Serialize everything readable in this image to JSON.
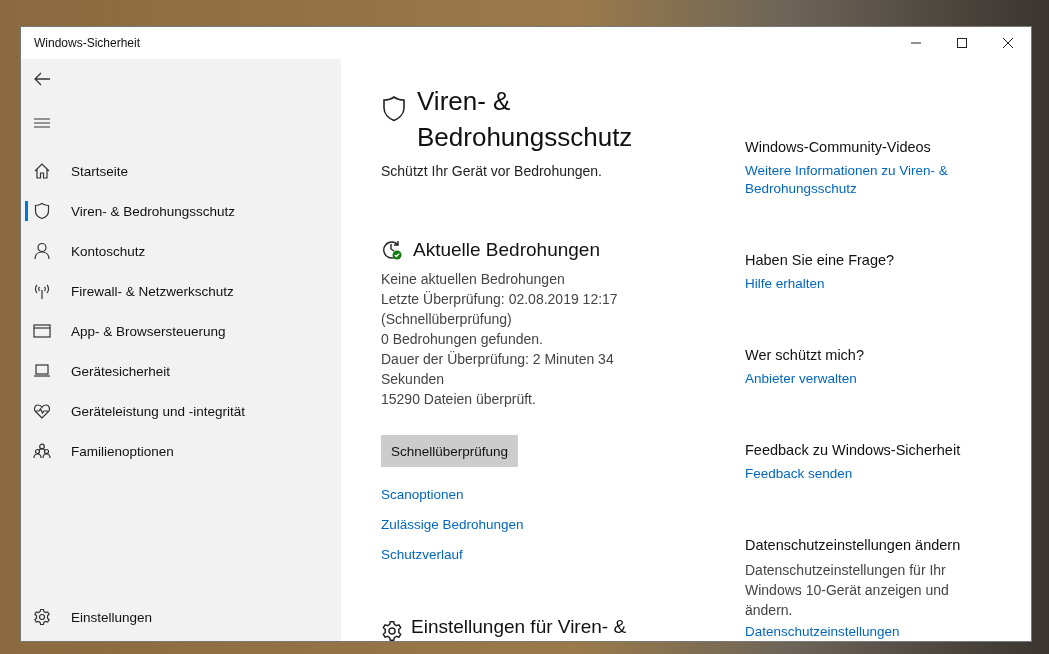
{
  "window": {
    "title": "Windows-Sicherheit"
  },
  "sidebar": {
    "items": [
      {
        "label": "Startseite",
        "selected": false
      },
      {
        "label": "Viren- & Bedrohungsschutz",
        "selected": true
      },
      {
        "label": "Kontoschutz",
        "selected": false
      },
      {
        "label": "Firewall- & Netzwerkschutz",
        "selected": false
      },
      {
        "label": "App- & Browsersteuerung",
        "selected": false
      },
      {
        "label": "Gerätesicherheit",
        "selected": false
      },
      {
        "label": "Geräteleistung und -integrität",
        "selected": false
      },
      {
        "label": "Familienoptionen",
        "selected": false
      }
    ],
    "settings": {
      "label": "Einstellungen",
      "selected": false
    }
  },
  "main": {
    "title": "Viren- & Bedrohungsschutz",
    "subtitle": "Schützt Ihr Gerät vor Bedrohungen.",
    "threats": {
      "heading": "Aktuelle Bedrohungen",
      "lines": [
        "Keine aktuellen Bedrohungen",
        "Letzte Überprüfung: 02.08.2019 12:17 (Schnellüberprüfung)",
        "0 Bedrohungen gefunden.",
        "Dauer der Überprüfung: 2 Minuten 34 Sekunden",
        "15290 Dateien überprüft."
      ],
      "button": "Schnellüberprüfung",
      "links": [
        "Scanoptionen",
        "Zulässige Bedrohungen",
        "Schutzverlauf"
      ]
    },
    "next_heading": "Einstellungen für Viren- &"
  },
  "aside": [
    {
      "heading": "Windows-Community-Videos",
      "link": "Weitere Informationen zu Viren- & Bedrohungsschutz"
    },
    {
      "heading": "Haben Sie eine Frage?",
      "link": "Hilfe erhalten"
    },
    {
      "heading": "Wer schützt mich?",
      "link": "Anbieter verwalten"
    },
    {
      "heading": "Feedback zu Windows-Sicherheit",
      "link": "Feedback senden"
    },
    {
      "heading": "Datenschutzeinstellungen ändern",
      "text": "Datenschutzeinstellungen für Ihr Windows 10-Gerät anzeigen und ändern.",
      "link": "Datenschutzeinstellungen"
    }
  ]
}
